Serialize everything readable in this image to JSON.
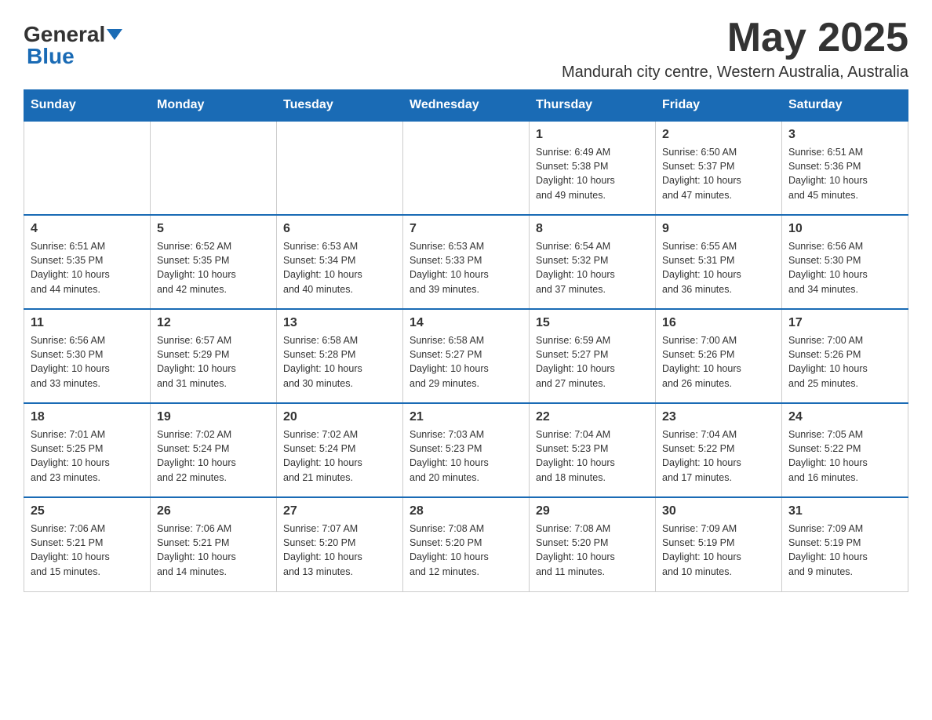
{
  "logo": {
    "text_general": "General",
    "text_blue": "Blue"
  },
  "header": {
    "month": "May 2025",
    "subtitle": "Mandurah city centre, Western Australia, Australia"
  },
  "weekdays": [
    "Sunday",
    "Monday",
    "Tuesday",
    "Wednesday",
    "Thursday",
    "Friday",
    "Saturday"
  ],
  "weeks": [
    [
      {
        "day": "",
        "info": ""
      },
      {
        "day": "",
        "info": ""
      },
      {
        "day": "",
        "info": ""
      },
      {
        "day": "",
        "info": ""
      },
      {
        "day": "1",
        "info": "Sunrise: 6:49 AM\nSunset: 5:38 PM\nDaylight: 10 hours\nand 49 minutes."
      },
      {
        "day": "2",
        "info": "Sunrise: 6:50 AM\nSunset: 5:37 PM\nDaylight: 10 hours\nand 47 minutes."
      },
      {
        "day": "3",
        "info": "Sunrise: 6:51 AM\nSunset: 5:36 PM\nDaylight: 10 hours\nand 45 minutes."
      }
    ],
    [
      {
        "day": "4",
        "info": "Sunrise: 6:51 AM\nSunset: 5:35 PM\nDaylight: 10 hours\nand 44 minutes."
      },
      {
        "day": "5",
        "info": "Sunrise: 6:52 AM\nSunset: 5:35 PM\nDaylight: 10 hours\nand 42 minutes."
      },
      {
        "day": "6",
        "info": "Sunrise: 6:53 AM\nSunset: 5:34 PM\nDaylight: 10 hours\nand 40 minutes."
      },
      {
        "day": "7",
        "info": "Sunrise: 6:53 AM\nSunset: 5:33 PM\nDaylight: 10 hours\nand 39 minutes."
      },
      {
        "day": "8",
        "info": "Sunrise: 6:54 AM\nSunset: 5:32 PM\nDaylight: 10 hours\nand 37 minutes."
      },
      {
        "day": "9",
        "info": "Sunrise: 6:55 AM\nSunset: 5:31 PM\nDaylight: 10 hours\nand 36 minutes."
      },
      {
        "day": "10",
        "info": "Sunrise: 6:56 AM\nSunset: 5:30 PM\nDaylight: 10 hours\nand 34 minutes."
      }
    ],
    [
      {
        "day": "11",
        "info": "Sunrise: 6:56 AM\nSunset: 5:30 PM\nDaylight: 10 hours\nand 33 minutes."
      },
      {
        "day": "12",
        "info": "Sunrise: 6:57 AM\nSunset: 5:29 PM\nDaylight: 10 hours\nand 31 minutes."
      },
      {
        "day": "13",
        "info": "Sunrise: 6:58 AM\nSunset: 5:28 PM\nDaylight: 10 hours\nand 30 minutes."
      },
      {
        "day": "14",
        "info": "Sunrise: 6:58 AM\nSunset: 5:27 PM\nDaylight: 10 hours\nand 29 minutes."
      },
      {
        "day": "15",
        "info": "Sunrise: 6:59 AM\nSunset: 5:27 PM\nDaylight: 10 hours\nand 27 minutes."
      },
      {
        "day": "16",
        "info": "Sunrise: 7:00 AM\nSunset: 5:26 PM\nDaylight: 10 hours\nand 26 minutes."
      },
      {
        "day": "17",
        "info": "Sunrise: 7:00 AM\nSunset: 5:26 PM\nDaylight: 10 hours\nand 25 minutes."
      }
    ],
    [
      {
        "day": "18",
        "info": "Sunrise: 7:01 AM\nSunset: 5:25 PM\nDaylight: 10 hours\nand 23 minutes."
      },
      {
        "day": "19",
        "info": "Sunrise: 7:02 AM\nSunset: 5:24 PM\nDaylight: 10 hours\nand 22 minutes."
      },
      {
        "day": "20",
        "info": "Sunrise: 7:02 AM\nSunset: 5:24 PM\nDaylight: 10 hours\nand 21 minutes."
      },
      {
        "day": "21",
        "info": "Sunrise: 7:03 AM\nSunset: 5:23 PM\nDaylight: 10 hours\nand 20 minutes."
      },
      {
        "day": "22",
        "info": "Sunrise: 7:04 AM\nSunset: 5:23 PM\nDaylight: 10 hours\nand 18 minutes."
      },
      {
        "day": "23",
        "info": "Sunrise: 7:04 AM\nSunset: 5:22 PM\nDaylight: 10 hours\nand 17 minutes."
      },
      {
        "day": "24",
        "info": "Sunrise: 7:05 AM\nSunset: 5:22 PM\nDaylight: 10 hours\nand 16 minutes."
      }
    ],
    [
      {
        "day": "25",
        "info": "Sunrise: 7:06 AM\nSunset: 5:21 PM\nDaylight: 10 hours\nand 15 minutes."
      },
      {
        "day": "26",
        "info": "Sunrise: 7:06 AM\nSunset: 5:21 PM\nDaylight: 10 hours\nand 14 minutes."
      },
      {
        "day": "27",
        "info": "Sunrise: 7:07 AM\nSunset: 5:20 PM\nDaylight: 10 hours\nand 13 minutes."
      },
      {
        "day": "28",
        "info": "Sunrise: 7:08 AM\nSunset: 5:20 PM\nDaylight: 10 hours\nand 12 minutes."
      },
      {
        "day": "29",
        "info": "Sunrise: 7:08 AM\nSunset: 5:20 PM\nDaylight: 10 hours\nand 11 minutes."
      },
      {
        "day": "30",
        "info": "Sunrise: 7:09 AM\nSunset: 5:19 PM\nDaylight: 10 hours\nand 10 minutes."
      },
      {
        "day": "31",
        "info": "Sunrise: 7:09 AM\nSunset: 5:19 PM\nDaylight: 10 hours\nand 9 minutes."
      }
    ]
  ]
}
